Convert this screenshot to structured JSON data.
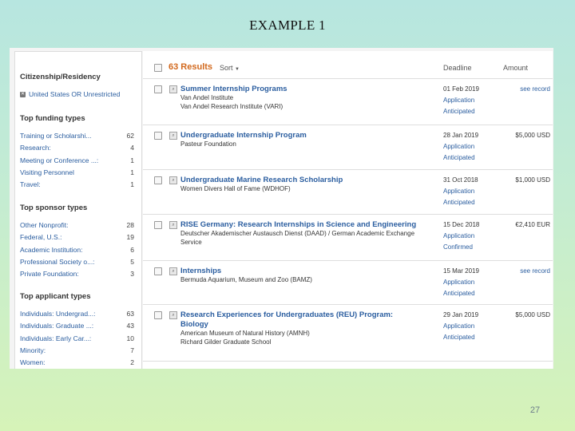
{
  "slide": {
    "title": "EXAMPLE 1",
    "page_number": "27"
  },
  "sidebar": {
    "citizenship_heading": "Citizenship/Residency",
    "citizenship_filter": "United States OR Unrestricted",
    "sections": [
      {
        "heading": "Top funding types",
        "items": [
          {
            "label": "Training or Scholarshi...",
            "count": "62"
          },
          {
            "label": "Research:",
            "count": "4"
          },
          {
            "label": "Meeting or Conference ...:",
            "count": "1"
          },
          {
            "label": "Visiting Personnel",
            "count": "1"
          },
          {
            "label": "Travel:",
            "count": "1"
          }
        ]
      },
      {
        "heading": "Top sponsor types",
        "items": [
          {
            "label": "Other Nonprofit:",
            "count": "28"
          },
          {
            "label": "Federal, U.S.:",
            "count": "19"
          },
          {
            "label": "Academic Institution:",
            "count": "6"
          },
          {
            "label": "Professional Society o...:",
            "count": "5"
          },
          {
            "label": "Private Foundation:",
            "count": "3"
          }
        ]
      },
      {
        "heading": "Top applicant types",
        "items": [
          {
            "label": "Individuals: Undergrad...:",
            "count": "63"
          },
          {
            "label": "Individuals: Graduate ...:",
            "count": "43"
          },
          {
            "label": "Individuals: Early Car...:",
            "count": "10"
          },
          {
            "label": "Minority:",
            "count": "7"
          },
          {
            "label": "Women:",
            "count": "2"
          }
        ]
      }
    ]
  },
  "results": {
    "count_label": "63 Results",
    "sort_label": "Sort",
    "columns": {
      "deadline": "Deadline",
      "amount": "Amount"
    },
    "rows": [
      {
        "title": "Summer Internship Programs",
        "title2": "",
        "sponsor_lines": [
          "Van Andel Institute",
          "Van Andel Research Institute (VARI)"
        ],
        "deadline": "01 Feb 2019",
        "status": [
          "Application",
          "Anticipated"
        ],
        "amount": "see record",
        "amount_is_link": true
      },
      {
        "title": "Undergraduate Internship Program",
        "title2": "",
        "sponsor_lines": [
          "Pasteur Foundation"
        ],
        "deadline": "28 Jan 2019",
        "status": [
          "Application",
          "Anticipated"
        ],
        "amount": "$5,000 USD",
        "amount_is_link": false
      },
      {
        "title": "Undergraduate Marine Research Scholarship",
        "title2": "",
        "sponsor_lines": [
          "Women Divers Hall of Fame (WDHOF)"
        ],
        "deadline": "31 Oct 2018",
        "status": [
          "Application",
          "Anticipated"
        ],
        "amount": "$1,000 USD",
        "amount_is_link": false
      },
      {
        "title": "RISE Germany: Research Internships in Science and Engineering",
        "title2": "",
        "sponsor_lines": [
          "Deutscher Akademischer Austausch Dienst (DAAD) / German Academic Exchange",
          "Service"
        ],
        "deadline": "15 Dec 2018",
        "status": [
          "Application",
          "Confirmed"
        ],
        "amount": "€2,410 EUR",
        "amount_is_link": false
      },
      {
        "title": "Internships",
        "title2": "",
        "sponsor_lines": [
          "Bermuda Aquarium, Museum and Zoo (BAMZ)"
        ],
        "deadline": "15 Mar 2019",
        "status": [
          "Application",
          "Anticipated"
        ],
        "amount": "see record",
        "amount_is_link": true
      },
      {
        "title": "Research Experiences for Undergraduates (REU) Program:",
        "title2": "Biology",
        "sponsor_lines": [
          "American Museum of Natural History (AMNH)",
          "Richard Gilder Graduate School"
        ],
        "deadline": "29 Jan 2019",
        "status": [
          "Application",
          "Anticipated"
        ],
        "amount": "$5,000 USD",
        "amount_is_link": false
      }
    ]
  }
}
